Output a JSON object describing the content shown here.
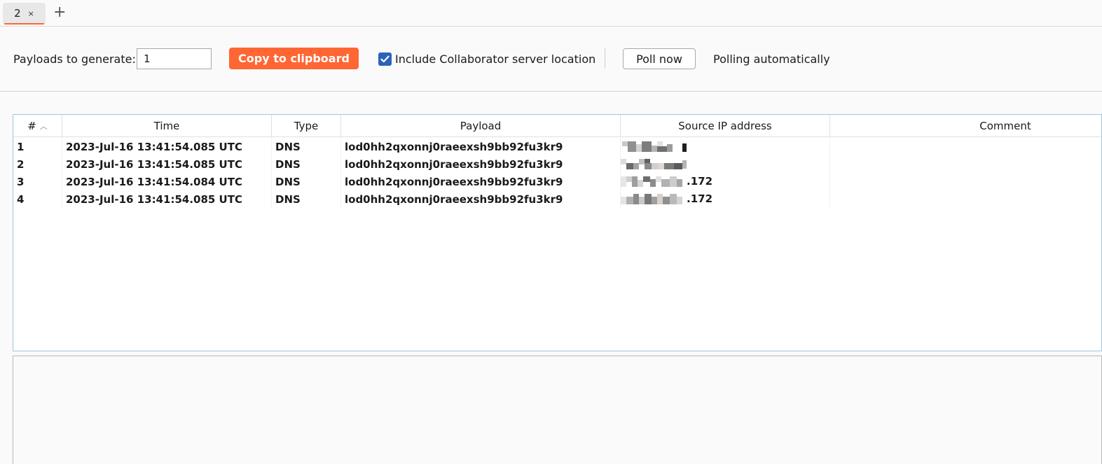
{
  "tabs": [
    {
      "label": "2",
      "close": "×"
    }
  ],
  "tab_add": "+",
  "toolbar": {
    "payloads_label": "Payloads to generate:",
    "payloads_value": "1",
    "copy_label": "Copy to clipboard",
    "include_label": "Include Collaborator server location",
    "include_checked": true,
    "poll_label": "Poll now",
    "status": "Polling automatically"
  },
  "table": {
    "columns": [
      "#",
      "Time",
      "Type",
      "Payload",
      "Source IP address",
      "Comment"
    ],
    "rows": [
      {
        "num": "1",
        "time": "2023-Jul-16 13:41:54.085 UTC",
        "type": "DNS",
        "payload": "lod0hh2qxonnj0raeexsh9bb92fu3kr9",
        "ip_suffix": "",
        "comment": ""
      },
      {
        "num": "2",
        "time": "2023-Jul-16 13:41:54.085 UTC",
        "type": "DNS",
        "payload": "lod0hh2qxonnj0raeexsh9bb92fu3kr9",
        "ip_suffix": "",
        "comment": ""
      },
      {
        "num": "3",
        "time": "2023-Jul-16 13:41:54.084 UTC",
        "type": "DNS",
        "payload": "lod0hh2qxonnj0raeexsh9bb92fu3kr9",
        "ip_suffix": ".172",
        "comment": ""
      },
      {
        "num": "4",
        "time": "2023-Jul-16 13:41:54.085 UTC",
        "type": "DNS",
        "payload": "lod0hh2qxonnj0raeexsh9bb92fu3kr9",
        "ip_suffix": ".172",
        "comment": ""
      }
    ]
  },
  "colors": {
    "accent": "#ff6633",
    "checkbox": "#2b63b8",
    "table_border": "#9cc7dc"
  }
}
